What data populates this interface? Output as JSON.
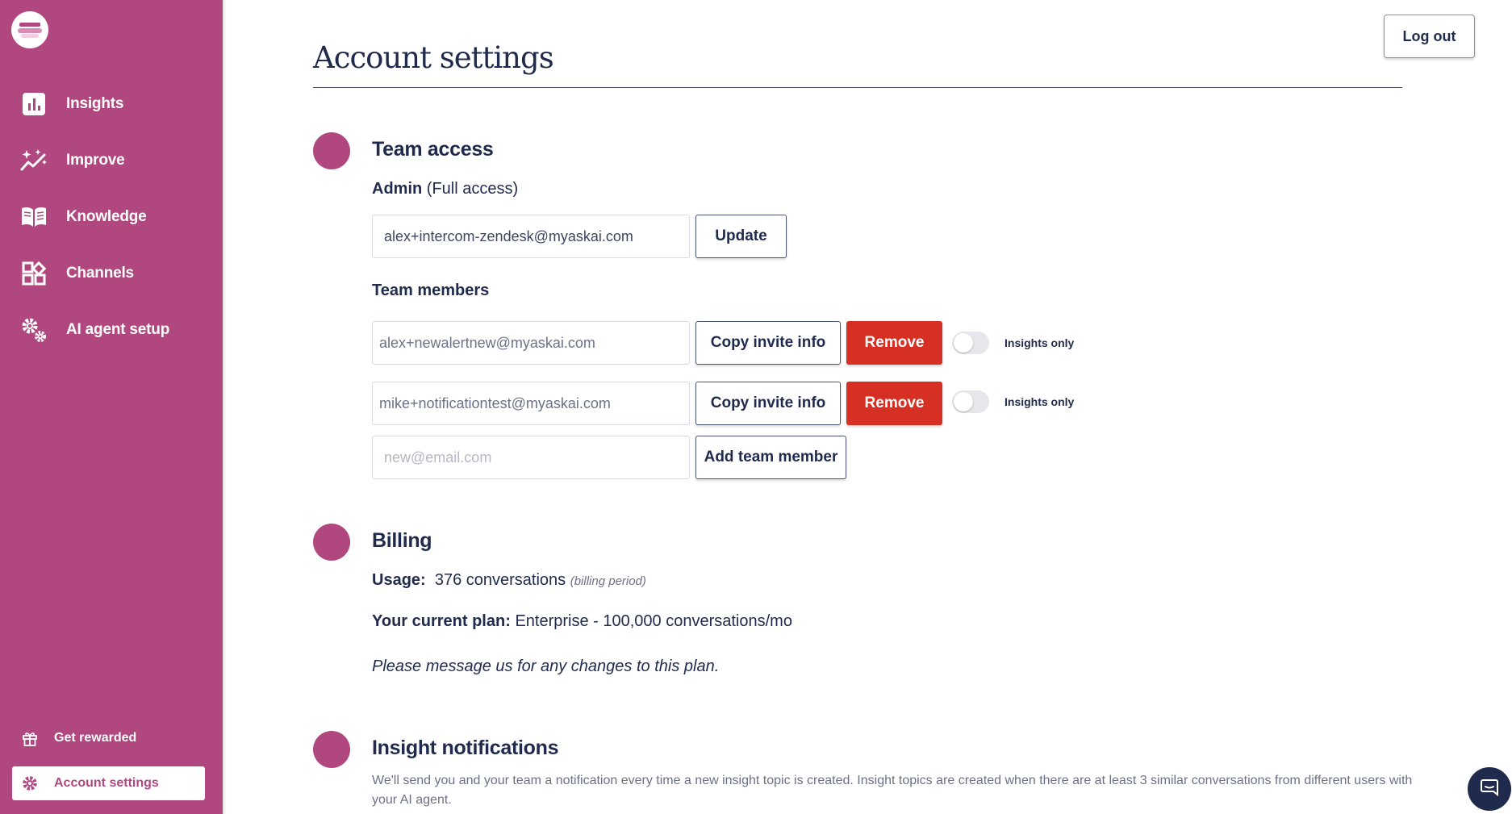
{
  "app": {
    "logo": "askai-logo-icon"
  },
  "sidebar": {
    "items": [
      {
        "label": "Insights",
        "icon": "bar-chart-icon"
      },
      {
        "label": "Improve",
        "icon": "sparkle-trend-icon"
      },
      {
        "label": "Knowledge",
        "icon": "book-icon"
      },
      {
        "label": "Channels",
        "icon": "grid-plus-icon"
      },
      {
        "label": "AI agent setup",
        "icon": "gears-icon"
      }
    ],
    "bottom": [
      {
        "label": "Get rewarded",
        "icon": "gift-icon"
      },
      {
        "label": "Account settings",
        "icon": "gear-icon",
        "active": true
      }
    ]
  },
  "header": {
    "title": "Account settings",
    "logout_label": "Log out"
  },
  "team_access": {
    "title": "Team access",
    "admin_label": "Admin",
    "admin_sub": "(Full access)",
    "admin_email": "alex+intercom-zendesk@myaskai.com",
    "update_label": "Update",
    "members_label": "Team members",
    "members": [
      {
        "email": "alex+newalertnew@myaskai.com",
        "copy_label": "Copy invite info",
        "remove_label": "Remove",
        "toggle_label": "Insights only",
        "insights_only": false
      },
      {
        "email": "mike+notificationtest@myaskai.com",
        "copy_label": "Copy invite info",
        "remove_label": "Remove",
        "toggle_label": "Insights only",
        "insights_only": false
      }
    ],
    "new_member_placeholder": "new@email.com",
    "add_member_label": "Add team member"
  },
  "billing": {
    "title": "Billing",
    "usage_label": "Usage:",
    "usage_value": "376 conversations",
    "usage_note": "(billing period)",
    "plan_label": "Your current plan:",
    "plan_value": "Enterprise - 100,000 conversations/mo",
    "message": "Please message us for any changes to this plan."
  },
  "notifications": {
    "title": "Insight notifications",
    "description": "We'll send you and your team a notification every time a new insight topic is created. Insight topics are created when there are at least 3 similar conversations from different users with your AI agent."
  },
  "colors": {
    "brand": "#b0477f",
    "navy": "#1f2a4d",
    "danger": "#d63024"
  }
}
